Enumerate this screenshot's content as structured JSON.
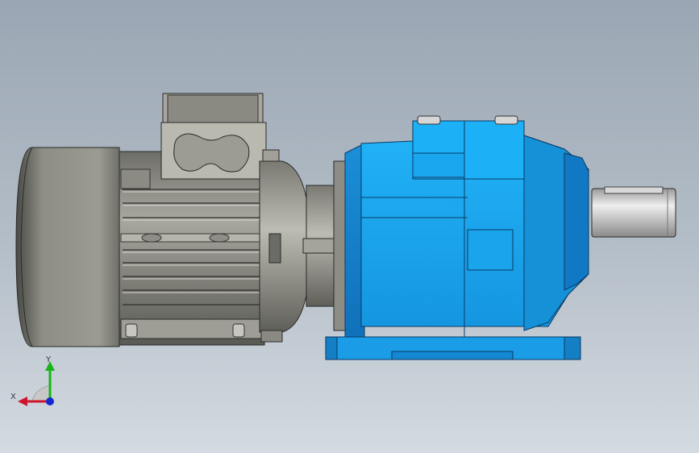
{
  "viewport": {
    "background_top": "#9aa6b3",
    "background_bottom": "#d4dae1"
  },
  "model": {
    "motor_color": "#8c8c84",
    "gearbox_color": "#1ea7ef",
    "shaft_color": "#c8c8c8"
  },
  "triad": {
    "x_label": "X",
    "y_label": "Y",
    "x_color": "#d0142c",
    "y_color": "#18b418",
    "z_color": "#1428d0"
  }
}
